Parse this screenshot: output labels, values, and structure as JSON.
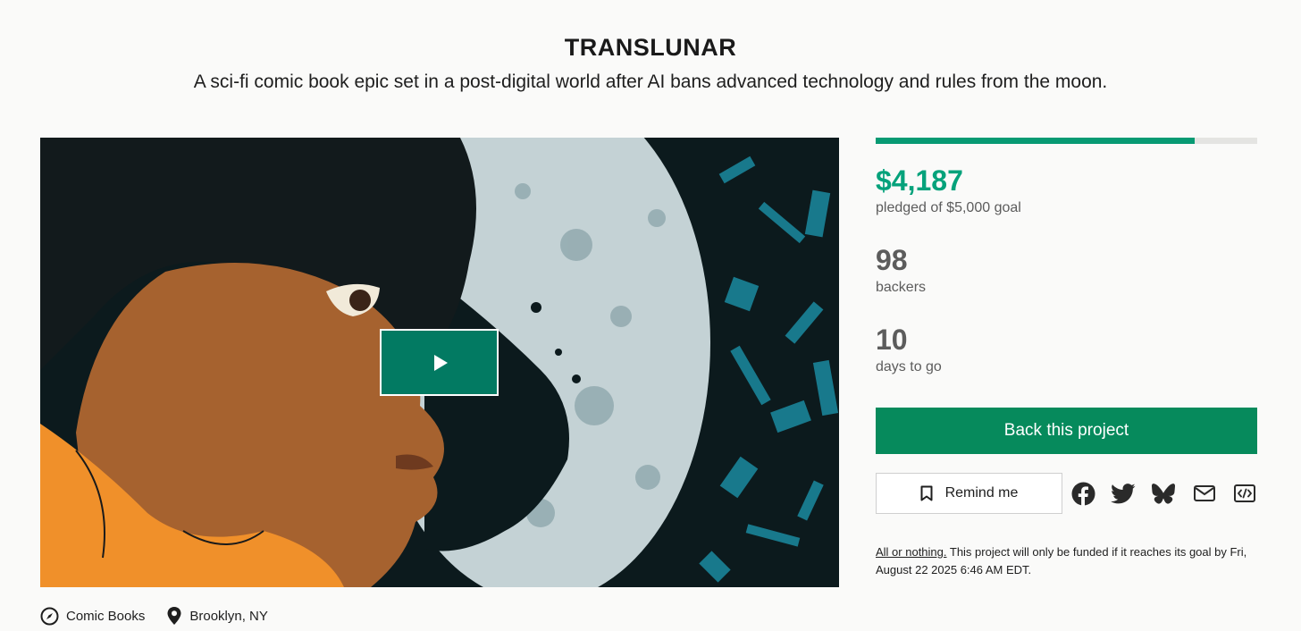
{
  "project": {
    "title": "TRANSLUNAR",
    "blurb": "A sci-fi comic book epic set in a post-digital world after AI bans advanced technology and rules from the moon."
  },
  "media": {
    "play_icon": "play-icon"
  },
  "meta": {
    "category": "Comic Books",
    "location": "Brooklyn, NY",
    "category_icon": "compass-icon",
    "location_icon": "map-pin-icon"
  },
  "funding": {
    "progress_fraction": 0.837,
    "pledged": "$4,187",
    "pledged_label": "pledged of $5,000 goal",
    "backers": "98",
    "backers_label": "backers",
    "days": "10",
    "days_label": "days to go"
  },
  "actions": {
    "back_label": "Back this project",
    "remind_label": "Remind me",
    "remind_icon": "bookmark-icon",
    "share_icons": [
      "facebook-icon",
      "twitter-icon",
      "bluesky-icon",
      "email-icon",
      "embed-icon"
    ]
  },
  "notice": {
    "link_text": "All or nothing.",
    "text": " This project will only be funded if it reaches its goal by Fri, August 22 2025 6:46 AM EDT."
  },
  "colors": {
    "accent": "#05a27b",
    "button": "#068a5c",
    "play_button": "#027a62"
  }
}
